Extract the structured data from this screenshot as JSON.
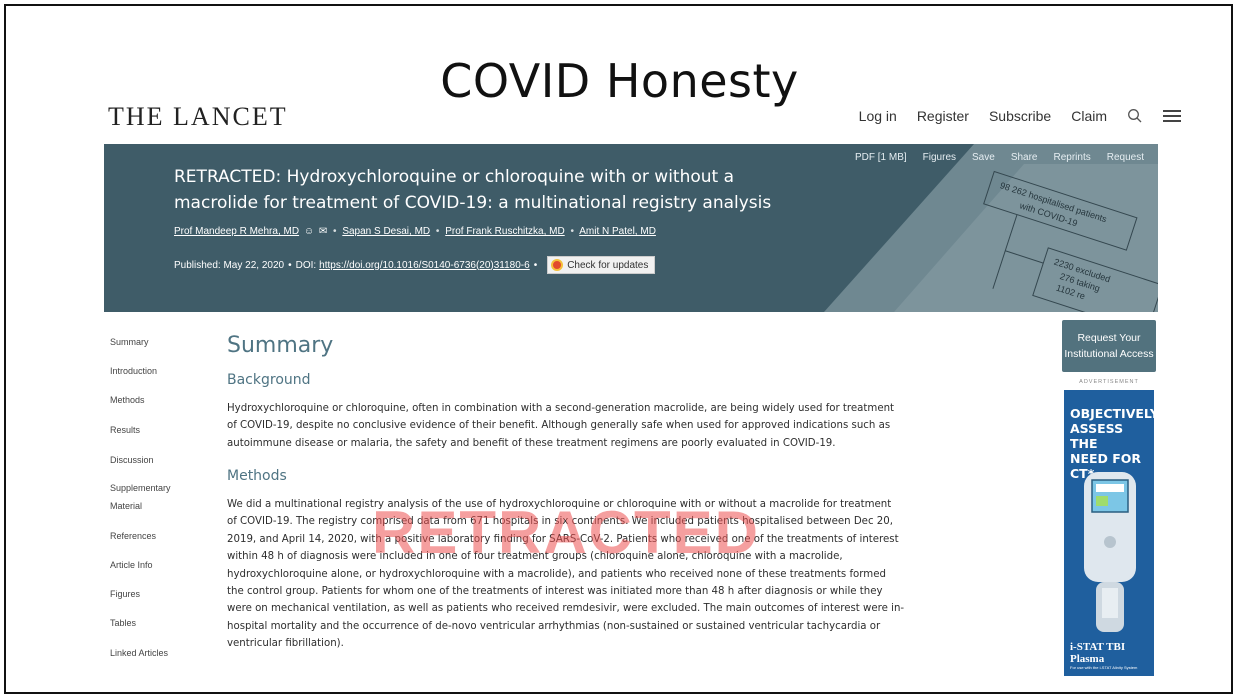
{
  "slide": {
    "title": "COVID Honesty"
  },
  "site": {
    "logo": "THE LANCET",
    "nav": {
      "login": "Log in",
      "register": "Register",
      "subscribe": "Subscribe",
      "claim": "Claim"
    }
  },
  "banner": {
    "links": [
      "PDF [1 MB]",
      "Figures",
      "Save",
      "Share",
      "Reprints",
      "Request"
    ],
    "title_line1": "RETRACTED: Hydroxychloroquine or chloroquine with or without a",
    "title_line2": "macrolide for treatment of COVID-19: a multinational registry analysis",
    "authors": [
      "Prof Mandeep R Mehra, MD",
      "Sapan S Desai, MD",
      "Prof Frank Ruschitzka, MD",
      "Amit N Patel, MD"
    ],
    "published": "Published: May 22, 2020",
    "doi_label": "DOI:",
    "doi": "https://doi.org/10.1016/S0140-6736(20)31180-6",
    "check_updates": "Check for updates",
    "flowchart": {
      "box1_line1": "98 262 hospitalised patients",
      "box1_line2": "with COVID-19",
      "box2_line1": "2230 excluded",
      "box2_line2": "276 taking",
      "box2_line3": "1102 re"
    }
  },
  "sidebar": {
    "items": [
      "Summary",
      "Introduction",
      "Methods",
      "Results",
      "Discussion",
      "Supplementary",
      "Material",
      "References",
      "Article Info",
      "Figures",
      "Tables",
      "Linked Articles"
    ]
  },
  "content": {
    "heading": "Summary",
    "background_heading": "Background",
    "background_lines": [
      "Hydroxychloroquine or chloroquine, often in combination with a second-generation macrolide, are being widely used for treatment",
      "of COVID-19, despite no conclusive evidence of their benefit. Although generally safe when used for approved indications such as",
      "autoimmune disease or malaria, the safety and benefit of these treatment regimens are poorly evaluated in COVID-19."
    ],
    "methods_heading": "Methods",
    "methods_lines": [
      "We did a multinational registry analysis of the use of hydroxychloroquine or chloroquine with or without a macrolide for treatment",
      "of COVID-19. The registry comprised data from 671 hospitals in six continents. We included patients hospitalised between Dec 20,",
      "2019, and April 14, 2020, with a positive laboratory finding for SARS-CoV-2. Patients who received one of the treatments of interest",
      "within 48 h of diagnosis were included in one of four treatment groups (chloroquine alone, chloroquine with a macrolide,",
      "hydroxychloroquine alone, or hydroxychloroquine with a macrolide), and patients who received none of these treatments formed",
      "the control group. Patients for whom one of the treatments of interest was initiated more than 48 h after diagnosis or while they",
      "were on mechanical ventilation, as well as patients who received remdesivir, were excluded. The main outcomes of interest were in-",
      "hospital mortality and the occurrence of de-novo ventricular arrhythmias (non-sustained or sustained ventricular tachycardia or",
      "ventricular fibrillation)."
    ],
    "watermark": "RETRACTED"
  },
  "right_rail": {
    "access_line1": "Request Your",
    "access_line2": "Institutional Access",
    "ad_label": "ADVERTISEMENT",
    "ad_line1": "OBJECTIVELY",
    "ad_line2": "ASSESS THE",
    "ad_line3": "NEED FOR CT*",
    "ad_product": "i-STAT TBI Plasma",
    "ad_product_sub": "For use with the i-STAT Alinity System"
  }
}
